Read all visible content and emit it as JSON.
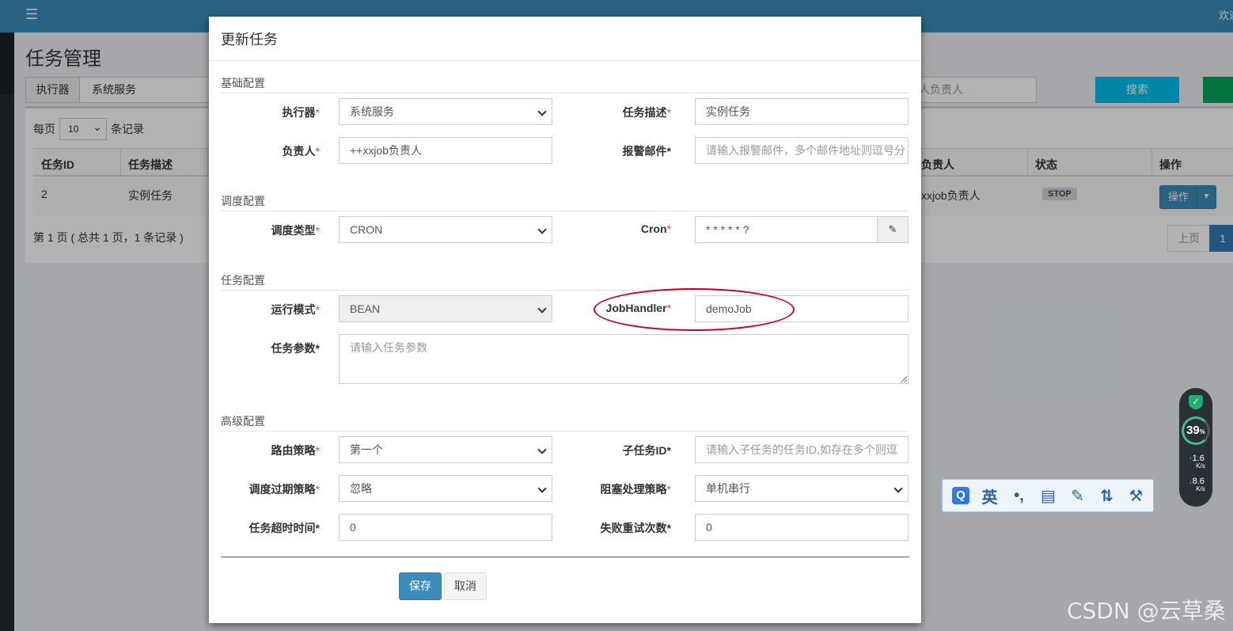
{
  "topbar": {
    "menu_icon": "hamburger-icon",
    "welcome": "欢迎"
  },
  "page": {
    "title": "任务管理"
  },
  "filter": {
    "executor_label": "执行器",
    "executor_value": "系统服务",
    "author_placeholder": "人负责人",
    "search_label": "搜索"
  },
  "list": {
    "per_page_label": "每页",
    "per_page_value": "10",
    "per_page_suffix": "条记录",
    "columns": [
      "任务ID",
      "任务描述",
      "负责人",
      "状态",
      "操作"
    ],
    "rows": [
      {
        "id": "2",
        "desc": "实例任务",
        "author": "xxjob负责人",
        "status": "STOP",
        "action": "操作"
      }
    ],
    "page_info": "第 1 页 ( 总共 1 页，1 条记录 )",
    "prev_label": "上页",
    "current_page": "1"
  },
  "modal": {
    "title": "更新任务",
    "sections": {
      "basic": "基础配置",
      "schedule": "调度配置",
      "task": "任务配置",
      "advanced": "高级配置"
    },
    "required_mark": "*",
    "fields": {
      "executor": {
        "label": "执行器",
        "value": "系统服务"
      },
      "job_desc": {
        "label": "任务描述",
        "value": "实例任务"
      },
      "author": {
        "label": "负责人",
        "value": "++xxjob负责人"
      },
      "alarm_email": {
        "label": "报警邮件",
        "placeholder": "请输入报警邮件，多个邮件地址则逗号分"
      },
      "schedule_type": {
        "label": "调度类型",
        "value": "CRON"
      },
      "cron": {
        "label": "Cron",
        "value": "* * * * * ?"
      },
      "glue_type": {
        "label": "运行模式",
        "value": "BEAN"
      },
      "job_handler": {
        "label": "JobHandler",
        "value": "demoJob"
      },
      "job_param": {
        "label": "任务参数",
        "placeholder": "请输入任务参数"
      },
      "route_strategy": {
        "label": "路由策略",
        "value": "第一个"
      },
      "child_job_id": {
        "label": "子任务ID",
        "placeholder": "请输入子任务的任务ID,如存在多个则逗"
      },
      "misfire_strategy": {
        "label": "调度过期策略",
        "value": "忽略"
      },
      "block_strategy": {
        "label": "阻塞处理策略",
        "value": "单机串行"
      },
      "timeout": {
        "label": "任务超时时间",
        "value": "0"
      },
      "fail_retry": {
        "label": "失败重试次数",
        "value": "0"
      }
    },
    "save_label": "保存",
    "cancel_label": "取消"
  },
  "ime_toolbar": {
    "brand": "Q",
    "mode": "英",
    "punct": "•,",
    "icons": [
      "notepad-icon",
      "edit-icon",
      "sort-icon",
      "wrench-icon"
    ]
  },
  "monitor": {
    "percent": "39",
    "percent_unit": "%",
    "up_speed": "1.6",
    "down_speed": "8.6",
    "speed_unit": "K/s"
  },
  "watermark": "CSDN @云草桑",
  "colors": {
    "primary": "#3c8dbc",
    "info": "#00c0ef",
    "success": "#00a65a",
    "required": "#dd4b39",
    "annotation": "#d0021b"
  }
}
